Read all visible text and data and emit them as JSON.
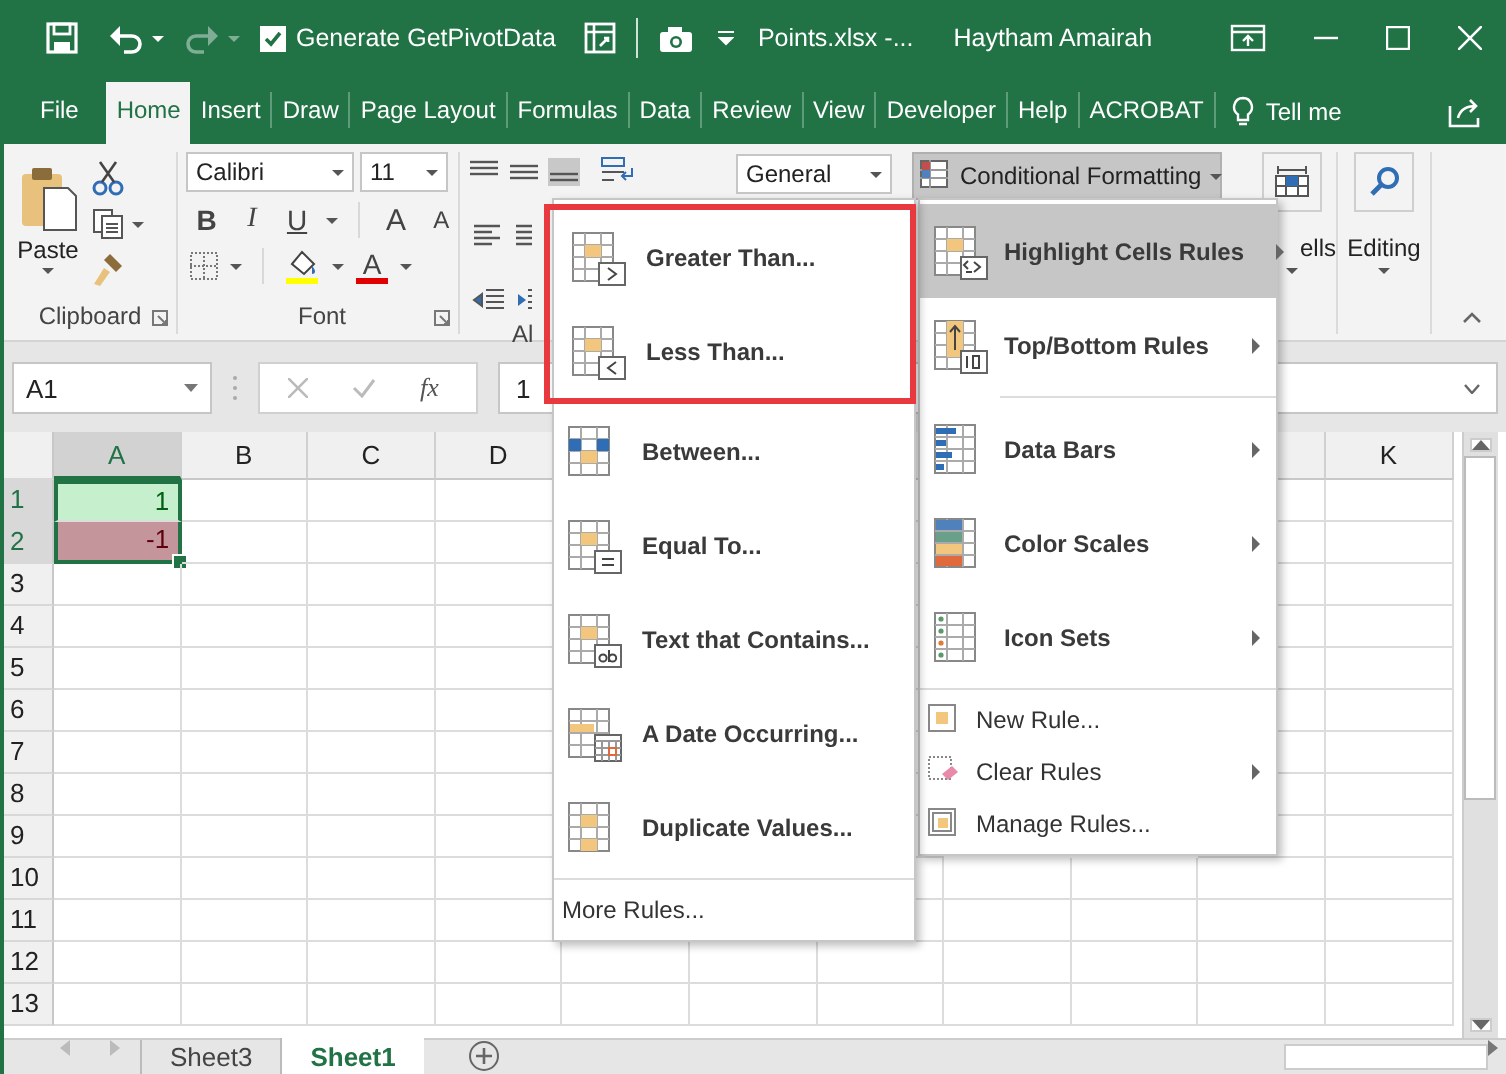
{
  "title_bar": {
    "quick_access": [
      {
        "kind": "save",
        "disabled": false
      },
      {
        "kind": "undo",
        "disabled": false
      },
      {
        "kind": "redo",
        "disabled": true
      }
    ],
    "pivot_option": {
      "label": "Generate GetPivotData",
      "checked": true
    },
    "document_title": "Points.xlsx  -...",
    "user_name": "Haytham Amairah"
  },
  "tabs": [
    {
      "label": "File",
      "selected": false
    },
    {
      "label": "Home",
      "selected": true
    },
    {
      "label": "Insert",
      "selected": false
    },
    {
      "label": "Draw",
      "selected": false
    },
    {
      "label": "Page Layout",
      "selected": false
    },
    {
      "label": "Formulas",
      "selected": false
    },
    {
      "label": "Data",
      "selected": false
    },
    {
      "label": "Review",
      "selected": false
    },
    {
      "label": "View",
      "selected": false
    },
    {
      "label": "Developer",
      "selected": false
    },
    {
      "label": "Help",
      "selected": false
    },
    {
      "label": "ACROBAT",
      "selected": false
    }
  ],
  "tell_me": "Tell me",
  "ribbon": {
    "paste": "Paste",
    "group_labels": [
      "Clipboard",
      "Font",
      "Al"
    ],
    "font_name": "Calibri",
    "font_size": "11",
    "font_buttons": [
      "B",
      "I",
      "U"
    ],
    "grow_font": "A",
    "shrink_font": "A",
    "font_color": "A",
    "number_format": "General",
    "conditional_formatting": {
      "label": "Conditional Formatting",
      "pressed": true
    },
    "cells": "ells",
    "editing": "Editing"
  },
  "formula_bar": {
    "name_box": "A1",
    "function_label": "fx",
    "value": "1"
  },
  "sheet": {
    "columns": [
      {
        "label": "A",
        "selected": true
      },
      {
        "label": "B",
        "selected": false
      },
      {
        "label": "C",
        "selected": false
      },
      {
        "label": "D",
        "selected": false
      },
      {
        "label": "K",
        "selected": false
      }
    ],
    "rows": [
      {
        "label": "1",
        "selected": true,
        "cells": [
          {
            "value": "1",
            "color": "#c6efce"
          }
        ]
      },
      {
        "label": "2",
        "selected": true,
        "cells": [
          {
            "value": "-1",
            "color": "#c4959b"
          }
        ]
      },
      {
        "label": "3",
        "selected": false
      },
      {
        "label": "4",
        "selected": false
      },
      {
        "label": "5",
        "selected": false
      },
      {
        "label": "6",
        "selected": false
      },
      {
        "label": "7",
        "selected": false
      },
      {
        "label": "8",
        "selected": false
      },
      {
        "label": "9",
        "selected": false
      },
      {
        "label": "10",
        "selected": false
      },
      {
        "label": "11",
        "selected": false
      },
      {
        "label": "12",
        "selected": false
      },
      {
        "label": "13",
        "selected": false
      }
    ]
  },
  "sheet_tabs": [
    {
      "label": "Sheet3",
      "selected": false
    },
    {
      "label": "Sheet1",
      "selected": true
    }
  ],
  "conditional_menu": {
    "groups": [
      {
        "items": [
          {
            "label": "Highlight Cells Rules",
            "kind": "highlight",
            "submenu": true,
            "selected": true
          },
          {
            "label": "Top/Bottom Rules",
            "kind": "topbottom",
            "submenu": true,
            "selected": false
          }
        ]
      },
      {
        "items": [
          {
            "label": "Data Bars",
            "kind": "databars",
            "submenu": true,
            "selected": false
          },
          {
            "label": "Color Scales",
            "kind": "colorscales",
            "submenu": true,
            "selected": false
          },
          {
            "label": "Icon Sets",
            "kind": "iconsets",
            "submenu": true,
            "selected": false
          }
        ]
      },
      {
        "items": [
          {
            "label": "New Rule...",
            "kind": "new",
            "submenu": false,
            "selected": false
          },
          {
            "label": "Clear Rules",
            "kind": "clear",
            "submenu": true,
            "selected": false
          },
          {
            "label": "Manage Rules...",
            "kind": "manage",
            "submenu": false,
            "selected": false
          }
        ]
      }
    ]
  },
  "highlight_submenu": {
    "items": [
      {
        "label": "Greater Than...",
        "kind": "greater",
        "framed": true
      },
      {
        "label": "Less Than...",
        "kind": "less",
        "framed": true
      },
      {
        "label": "Between...",
        "kind": "between",
        "framed": false
      },
      {
        "label": "Equal To...",
        "kind": "equal",
        "framed": false
      },
      {
        "label": "Text that Contains...",
        "kind": "text",
        "framed": false
      },
      {
        "label": "A Date Occurring...",
        "kind": "date",
        "framed": false
      },
      {
        "label": "Duplicate Values...",
        "kind": "duplicate",
        "framed": false
      }
    ],
    "more": "More Rules..."
  }
}
